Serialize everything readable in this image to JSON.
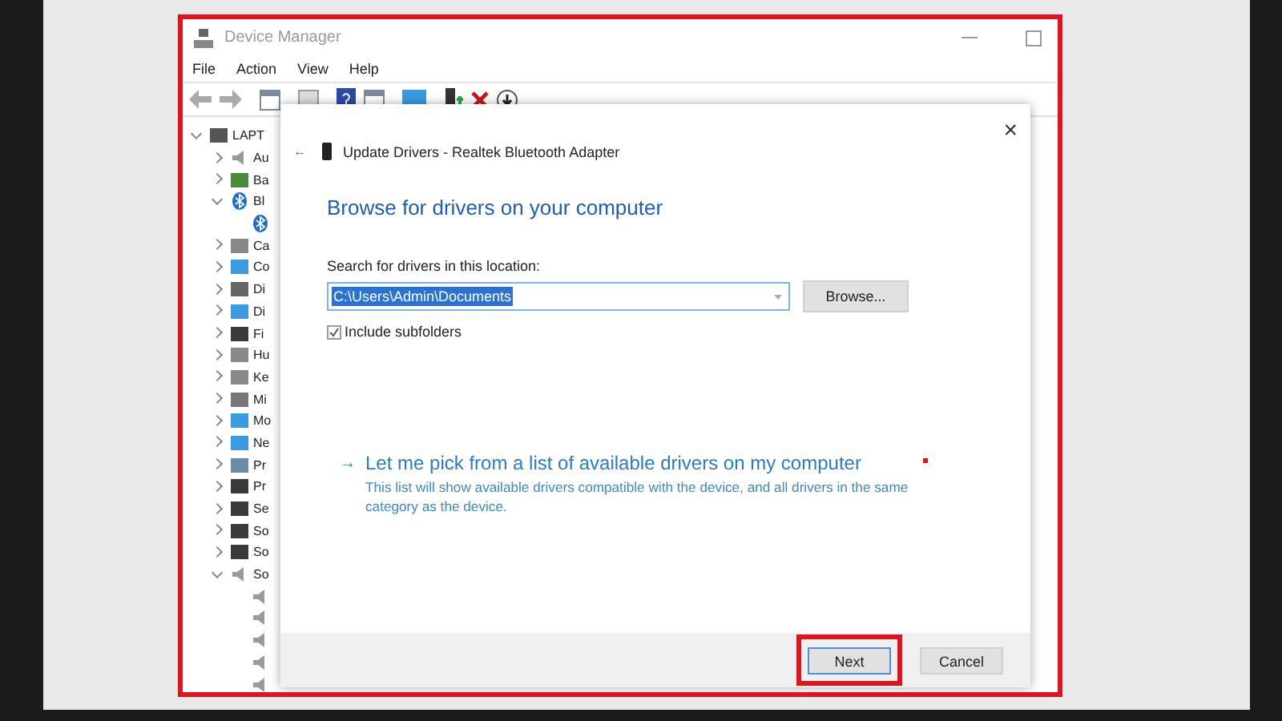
{
  "window": {
    "title": "Device Manager"
  },
  "menu": [
    "File",
    "Action",
    "View",
    "Help"
  ],
  "tree": [
    {
      "label": "LAPT",
      "kind": "computer",
      "expanded": true,
      "children": [
        {
          "label": "Au",
          "kind": "speaker",
          "expanded": false
        },
        {
          "label": "Ba",
          "kind": "battery",
          "expanded": false
        },
        {
          "label": "Bl",
          "kind": "bluetooth",
          "expanded": true,
          "children": [
            {
              "kind": "bluetooth"
            }
          ]
        },
        {
          "label": "Ca",
          "kind": "camera",
          "expanded": false
        },
        {
          "label": "Co",
          "kind": "monitor",
          "expanded": false
        },
        {
          "label": "Di",
          "kind": "disk",
          "expanded": false
        },
        {
          "label": "Di",
          "kind": "monitor",
          "expanded": false
        },
        {
          "label": "Fi",
          "kind": "chip",
          "expanded": false
        },
        {
          "label": "Hu",
          "kind": "keyboard",
          "expanded": false
        },
        {
          "label": "Ke",
          "kind": "keyboard",
          "expanded": false
        },
        {
          "label": "Mi",
          "kind": "mouse",
          "expanded": false
        },
        {
          "label": "Mo",
          "kind": "monitor",
          "expanded": false
        },
        {
          "label": "Ne",
          "kind": "monitor",
          "expanded": false
        },
        {
          "label": "Pr",
          "kind": "printer",
          "expanded": false
        },
        {
          "label": "Pr",
          "kind": "chip",
          "expanded": false
        },
        {
          "label": "Se",
          "kind": "chip",
          "expanded": false
        },
        {
          "label": "So",
          "kind": "chip",
          "expanded": false
        },
        {
          "label": "So",
          "kind": "chip",
          "expanded": false
        },
        {
          "label": "So",
          "kind": "speaker",
          "expanded": true,
          "children": [
            {
              "kind": "speaker"
            },
            {
              "kind": "speaker"
            },
            {
              "kind": "speaker"
            },
            {
              "kind": "speaker"
            },
            {
              "kind": "speaker"
            }
          ]
        }
      ]
    }
  ],
  "dialog": {
    "title": "Update Drivers - Realtek Bluetooth Adapter",
    "close": "×",
    "back": "←",
    "heading": "Browse for drivers on your computer",
    "location_label": "Search for drivers in this location:",
    "location_value": "C:\\Users\\Admin\\Documents",
    "browse_button": "Browse...",
    "include_subfolders": {
      "label": "Include subfolders",
      "checked": true
    },
    "link": {
      "arrow": "→",
      "text": "Let me pick from a list of available drivers on my computer",
      "description": "This list will show available drivers compatible with the device, and all drivers in the same category as the device."
    },
    "buttons": [
      {
        "label": "Next",
        "highlighted": true
      },
      {
        "label": "Cancel",
        "highlighted": false
      }
    ]
  }
}
